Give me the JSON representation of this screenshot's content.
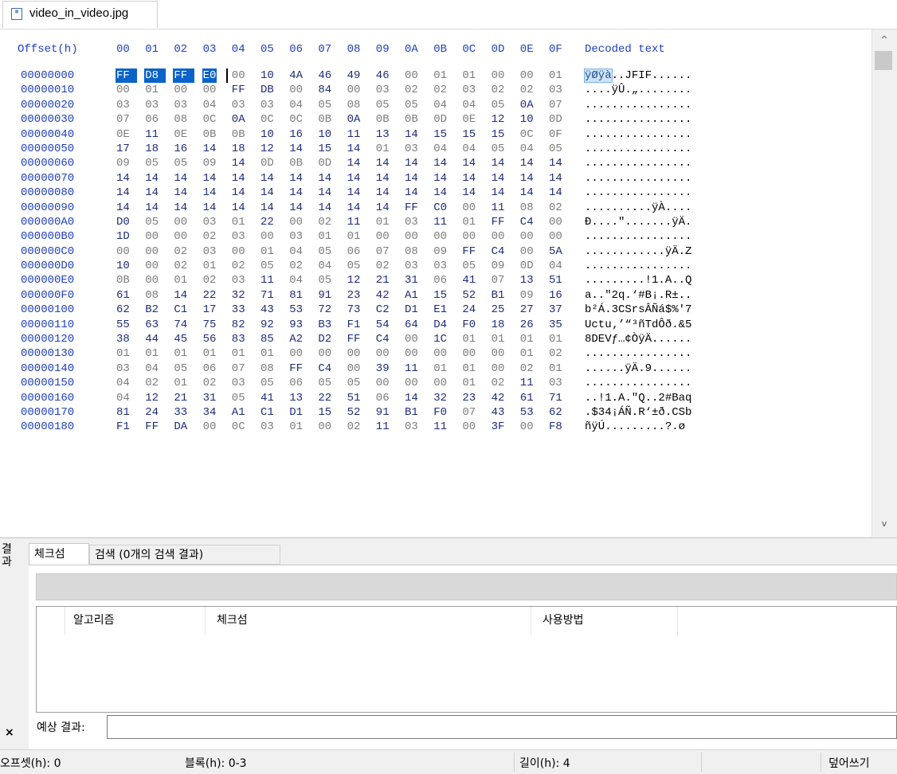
{
  "file_tab": {
    "name": "video_in_video.jpg",
    "icon": "image-file-icon"
  },
  "hex": {
    "offset_header": "Offset(h)",
    "columns": [
      "00",
      "01",
      "02",
      "03",
      "04",
      "05",
      "06",
      "07",
      "08",
      "09",
      "0A",
      "0B",
      "0C",
      "0D",
      "0E",
      "0F"
    ],
    "decoded_header": "Decoded text",
    "rows": [
      {
        "offset": "00000000",
        "bytes": [
          "FF",
          "D8",
          "FF",
          "E0",
          "00",
          "10",
          "4A",
          "46",
          "49",
          "46",
          "00",
          "01",
          "01",
          "00",
          "00",
          "01"
        ],
        "text": "ÿØÿà..JFIF......"
      },
      {
        "offset": "00000010",
        "bytes": [
          "00",
          "01",
          "00",
          "00",
          "FF",
          "DB",
          "00",
          "84",
          "00",
          "03",
          "02",
          "02",
          "03",
          "02",
          "02",
          "03"
        ],
        "text": "....ÿÛ.„........"
      },
      {
        "offset": "00000020",
        "bytes": [
          "03",
          "03",
          "03",
          "04",
          "03",
          "03",
          "04",
          "05",
          "08",
          "05",
          "05",
          "04",
          "04",
          "05",
          "0A",
          "07"
        ],
        "text": "................"
      },
      {
        "offset": "00000030",
        "bytes": [
          "07",
          "06",
          "08",
          "0C",
          "0A",
          "0C",
          "0C",
          "0B",
          "0A",
          "0B",
          "0B",
          "0D",
          "0E",
          "12",
          "10",
          "0D"
        ],
        "text": "................"
      },
      {
        "offset": "00000040",
        "bytes": [
          "0E",
          "11",
          "0E",
          "0B",
          "0B",
          "10",
          "16",
          "10",
          "11",
          "13",
          "14",
          "15",
          "15",
          "15",
          "0C",
          "0F"
        ],
        "text": "................"
      },
      {
        "offset": "00000050",
        "bytes": [
          "17",
          "18",
          "16",
          "14",
          "18",
          "12",
          "14",
          "15",
          "14",
          "01",
          "03",
          "04",
          "04",
          "05",
          "04",
          "05"
        ],
        "text": "................"
      },
      {
        "offset": "00000060",
        "bytes": [
          "09",
          "05",
          "05",
          "09",
          "14",
          "0D",
          "0B",
          "0D",
          "14",
          "14",
          "14",
          "14",
          "14",
          "14",
          "14",
          "14"
        ],
        "text": "................"
      },
      {
        "offset": "00000070",
        "bytes": [
          "14",
          "14",
          "14",
          "14",
          "14",
          "14",
          "14",
          "14",
          "14",
          "14",
          "14",
          "14",
          "14",
          "14",
          "14",
          "14"
        ],
        "text": "................"
      },
      {
        "offset": "00000080",
        "bytes": [
          "14",
          "14",
          "14",
          "14",
          "14",
          "14",
          "14",
          "14",
          "14",
          "14",
          "14",
          "14",
          "14",
          "14",
          "14",
          "14"
        ],
        "text": "................"
      },
      {
        "offset": "00000090",
        "bytes": [
          "14",
          "14",
          "14",
          "14",
          "14",
          "14",
          "14",
          "14",
          "14",
          "14",
          "FF",
          "C0",
          "00",
          "11",
          "08",
          "02"
        ],
        "text": "..........ÿÀ...."
      },
      {
        "offset": "000000A0",
        "bytes": [
          "D0",
          "05",
          "00",
          "03",
          "01",
          "22",
          "00",
          "02",
          "11",
          "01",
          "03",
          "11",
          "01",
          "FF",
          "C4",
          "00"
        ],
        "text": "Ð....\".......ÿÄ."
      },
      {
        "offset": "000000B0",
        "bytes": [
          "1D",
          "00",
          "00",
          "02",
          "03",
          "00",
          "03",
          "01",
          "01",
          "00",
          "00",
          "00",
          "00",
          "00",
          "00",
          "00"
        ],
        "text": "................"
      },
      {
        "offset": "000000C0",
        "bytes": [
          "00",
          "00",
          "02",
          "03",
          "00",
          "01",
          "04",
          "05",
          "06",
          "07",
          "08",
          "09",
          "FF",
          "C4",
          "00",
          "5A"
        ],
        "text": "............ÿÄ.Z"
      },
      {
        "offset": "000000D0",
        "bytes": [
          "10",
          "00",
          "02",
          "01",
          "02",
          "05",
          "02",
          "04",
          "05",
          "02",
          "03",
          "03",
          "05",
          "09",
          "0D",
          "04"
        ],
        "text": "................"
      },
      {
        "offset": "000000E0",
        "bytes": [
          "0B",
          "00",
          "01",
          "02",
          "03",
          "11",
          "04",
          "05",
          "12",
          "21",
          "31",
          "06",
          "41",
          "07",
          "13",
          "51"
        ],
        "text": ".........!1.A..Q"
      },
      {
        "offset": "000000F0",
        "bytes": [
          "61",
          "08",
          "14",
          "22",
          "32",
          "71",
          "81",
          "91",
          "23",
          "42",
          "A1",
          "15",
          "52",
          "B1",
          "09",
          "16"
        ],
        "text": "a..\"2q.‘#B¡.R±.."
      },
      {
        "offset": "00000100",
        "bytes": [
          "62",
          "B2",
          "C1",
          "17",
          "33",
          "43",
          "53",
          "72",
          "73",
          "C2",
          "D1",
          "E1",
          "24",
          "25",
          "27",
          "37"
        ],
        "text": "b²Á.3CSrsÂÑá$%'7"
      },
      {
        "offset": "00000110",
        "bytes": [
          "55",
          "63",
          "74",
          "75",
          "82",
          "92",
          "93",
          "B3",
          "F1",
          "54",
          "64",
          "D4",
          "F0",
          "18",
          "26",
          "35"
        ],
        "text": "Uctu‚’“³ñTdÔð.&5"
      },
      {
        "offset": "00000120",
        "bytes": [
          "38",
          "44",
          "45",
          "56",
          "83",
          "85",
          "A2",
          "D2",
          "FF",
          "C4",
          "00",
          "1C",
          "01",
          "01",
          "01",
          "01"
        ],
        "text": "8DEVƒ…¢ÒÿÄ......"
      },
      {
        "offset": "00000130",
        "bytes": [
          "01",
          "01",
          "01",
          "01",
          "01",
          "01",
          "00",
          "00",
          "00",
          "00",
          "00",
          "00",
          "00",
          "00",
          "01",
          "02"
        ],
        "text": "................"
      },
      {
        "offset": "00000140",
        "bytes": [
          "03",
          "04",
          "05",
          "06",
          "07",
          "08",
          "FF",
          "C4",
          "00",
          "39",
          "11",
          "01",
          "01",
          "00",
          "02",
          "01"
        ],
        "text": "......ÿÄ.9......"
      },
      {
        "offset": "00000150",
        "bytes": [
          "04",
          "02",
          "01",
          "02",
          "03",
          "05",
          "06",
          "05",
          "05",
          "00",
          "00",
          "00",
          "01",
          "02",
          "11",
          "03"
        ],
        "text": "................"
      },
      {
        "offset": "00000160",
        "bytes": [
          "04",
          "12",
          "21",
          "31",
          "05",
          "41",
          "13",
          "22",
          "51",
          "06",
          "14",
          "32",
          "23",
          "42",
          "61",
          "71"
        ],
        "text": "..!1.A.\"Q..2#Baq"
      },
      {
        "offset": "00000170",
        "bytes": [
          "81",
          "24",
          "33",
          "34",
          "A1",
          "C1",
          "D1",
          "15",
          "52",
          "91",
          "B1",
          "F0",
          "07",
          "43",
          "53",
          "62"
        ],
        "text": ".$34¡ÁÑ.R‘±ð.CSb"
      },
      {
        "offset": "00000180",
        "bytes": [
          "F1",
          "FF",
          "DA",
          "00",
          "0C",
          "03",
          "01",
          "00",
          "02",
          "11",
          "03",
          "11",
          "00",
          "3F",
          "00",
          "F8"
        ],
        "text": "ñÿÚ.........?.ø"
      }
    ]
  },
  "results": {
    "panel_label": "결과",
    "close_glyph": "×",
    "tabs": [
      "체크섬",
      "검색 (0개의 검색 결과)"
    ],
    "columns": [
      "알고리즘",
      "체크섬",
      "사용방법"
    ],
    "expected_label": "예상 결과:",
    "expected_value": ""
  },
  "status": {
    "offset": "오프셋(h): 0",
    "block": "블록(h): 0-3",
    "length": "길이(h): 4",
    "mode": "덮어쓰기"
  }
}
